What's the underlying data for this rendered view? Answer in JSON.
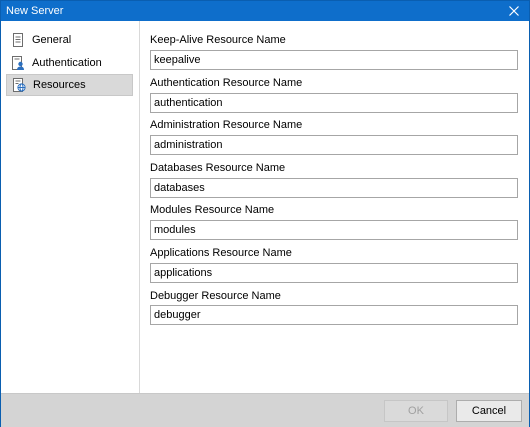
{
  "window": {
    "title": "New Server",
    "title_bar_color": "#0e6ecb"
  },
  "sidebar": {
    "items": [
      {
        "label": "General",
        "icon": "general-page-icon",
        "selected": false
      },
      {
        "label": "Authentication",
        "icon": "user-badge-icon",
        "selected": false
      },
      {
        "label": "Resources",
        "icon": "resource-globe-icon",
        "selected": true
      }
    ]
  },
  "fields": [
    {
      "label": "Keep-Alive Resource Name",
      "value": "keepalive"
    },
    {
      "label": "Authentication Resource Name",
      "value": "authentication"
    },
    {
      "label": "Administration Resource Name",
      "value": "administration"
    },
    {
      "label": "Databases Resource Name",
      "value": "databases"
    },
    {
      "label": "Modules Resource Name",
      "value": "modules"
    },
    {
      "label": "Applications Resource Name",
      "value": "applications"
    },
    {
      "label": "Debugger Resource Name",
      "value": "debugger"
    }
  ],
  "footer": {
    "ok_label": "OK",
    "ok_enabled": false,
    "cancel_label": "Cancel"
  }
}
